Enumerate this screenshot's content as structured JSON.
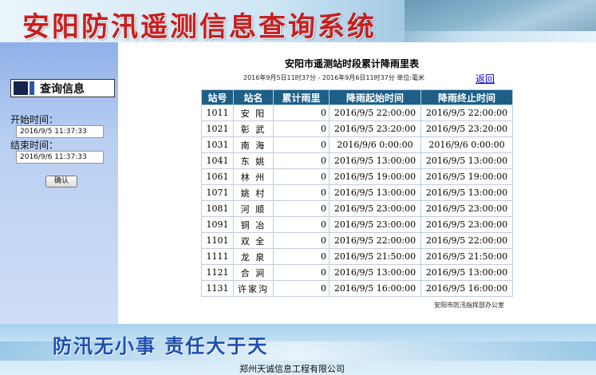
{
  "header": {
    "title": "安阳防汛遥测信息查询系统"
  },
  "sidebar": {
    "badge_label": "查询信息",
    "start_label": "开始时间：",
    "start_value": "2016/9/5 11:37:33",
    "end_label": "结束时间：",
    "end_value": "2016/9/6 11:37:33",
    "confirm_label": "确认"
  },
  "report": {
    "title": "安阳市遥测站时段累计降雨里表",
    "subtitle": "2016年9月5日11时37分 - 2016年9月6日11时37分  单位:毫米",
    "back_link": "返回",
    "columns": [
      "站号",
      "站名",
      "累计雨里",
      "降雨起始时间",
      "降雨终止时间"
    ],
    "rows": [
      [
        "1011",
        "安 阳",
        "0",
        "2016/9/5 22:00:00",
        "2016/9/5 22:00:00"
      ],
      [
        "1021",
        "彰 武",
        "0",
        "2016/9/5 23:20:00",
        "2016/9/5 23:20:00"
      ],
      [
        "1031",
        "南 海",
        "0",
        "2016/9/6 0:00:00",
        "2016/9/6 0:00:00"
      ],
      [
        "1041",
        "东 姚",
        "0",
        "2016/9/5 13:00:00",
        "2016/9/5 13:00:00"
      ],
      [
        "1061",
        "林 州",
        "0",
        "2016/9/5 19:00:00",
        "2016/9/5 19:00:00"
      ],
      [
        "1071",
        "姚 村",
        "0",
        "2016/9/5 13:00:00",
        "2016/9/5 13:00:00"
      ],
      [
        "1081",
        "河 顺",
        "0",
        "2016/9/5 23:00:00",
        "2016/9/5 23:00:00"
      ],
      [
        "1091",
        "铜 冶",
        "0",
        "2016/9/5 23:00:00",
        "2016/9/5 23:00:00"
      ],
      [
        "1101",
        "双 全",
        "0",
        "2016/9/5 22:00:00",
        "2016/9/5 22:00:00"
      ],
      [
        "1111",
        "龙 泉",
        "0",
        "2016/9/5 21:50:00",
        "2016/9/5 21:50:00"
      ],
      [
        "1121",
        "合 涧",
        "0",
        "2016/9/5 13:00:00",
        "2016/9/5 13:00:00"
      ],
      [
        "1131",
        "许家沟",
        "0",
        "2016/9/5 16:00:00",
        "2016/9/5 16:00:00"
      ]
    ],
    "footer_org": "安阳市防汛指挥部办公室"
  },
  "banner": {
    "slogan": "防汛无小事  责任大于天",
    "company": "郑州天诚信息工程有限公司"
  }
}
